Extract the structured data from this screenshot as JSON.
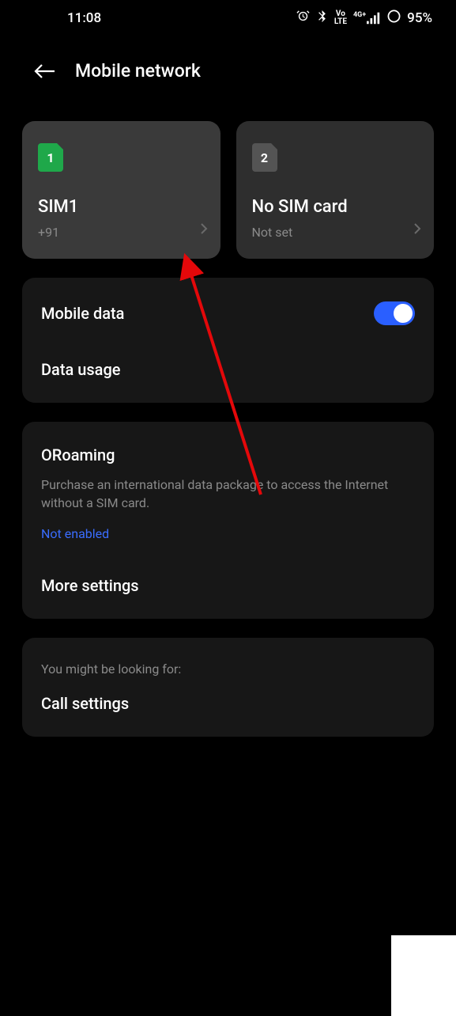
{
  "status": {
    "time": "11:08",
    "battery": "95%",
    "net_label": "4G+",
    "vo_label": "Vo\nLTE"
  },
  "header": {
    "title": "Mobile network"
  },
  "sims": [
    {
      "num": "1",
      "name": "SIM1",
      "sub": "+91",
      "active": true
    },
    {
      "num": "2",
      "name": "No SIM card",
      "sub": "Not set",
      "active": false
    }
  ],
  "section1": {
    "mobile_data": "Mobile data",
    "data_usage": "Data usage"
  },
  "section2": {
    "oroaming_title": "ORoaming",
    "oroaming_desc": "Purchase an international data package to access the Internet without a SIM card.",
    "oroaming_status": "Not enabled",
    "more_settings": "More settings"
  },
  "section3": {
    "hint": "You might be looking for:",
    "call_settings": "Call settings"
  }
}
